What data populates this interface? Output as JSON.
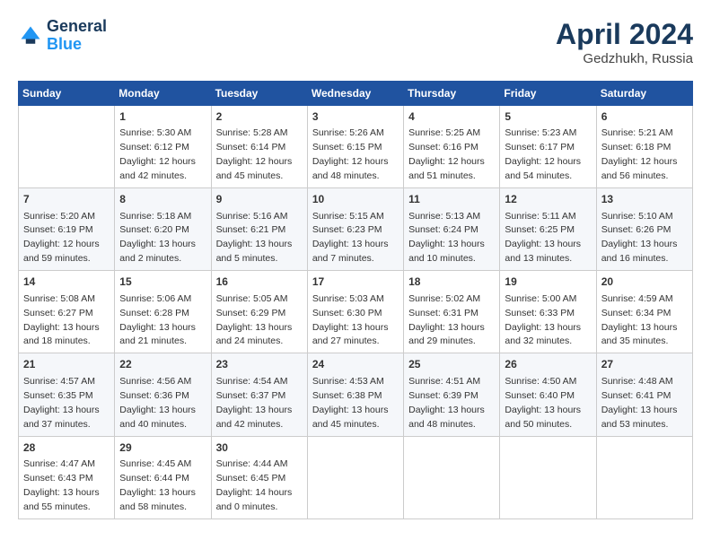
{
  "header": {
    "logo_general": "General",
    "logo_blue": "Blue",
    "month": "April 2024",
    "location": "Gedzhukh, Russia"
  },
  "weekdays": [
    "Sunday",
    "Monday",
    "Tuesday",
    "Wednesday",
    "Thursday",
    "Friday",
    "Saturday"
  ],
  "weeks": [
    [
      {
        "day": "",
        "info": ""
      },
      {
        "day": "1",
        "info": "Sunrise: 5:30 AM\nSunset: 6:12 PM\nDaylight: 12 hours\nand 42 minutes."
      },
      {
        "day": "2",
        "info": "Sunrise: 5:28 AM\nSunset: 6:14 PM\nDaylight: 12 hours\nand 45 minutes."
      },
      {
        "day": "3",
        "info": "Sunrise: 5:26 AM\nSunset: 6:15 PM\nDaylight: 12 hours\nand 48 minutes."
      },
      {
        "day": "4",
        "info": "Sunrise: 5:25 AM\nSunset: 6:16 PM\nDaylight: 12 hours\nand 51 minutes."
      },
      {
        "day": "5",
        "info": "Sunrise: 5:23 AM\nSunset: 6:17 PM\nDaylight: 12 hours\nand 54 minutes."
      },
      {
        "day": "6",
        "info": "Sunrise: 5:21 AM\nSunset: 6:18 PM\nDaylight: 12 hours\nand 56 minutes."
      }
    ],
    [
      {
        "day": "7",
        "info": "Sunrise: 5:20 AM\nSunset: 6:19 PM\nDaylight: 12 hours\nand 59 minutes."
      },
      {
        "day": "8",
        "info": "Sunrise: 5:18 AM\nSunset: 6:20 PM\nDaylight: 13 hours\nand 2 minutes."
      },
      {
        "day": "9",
        "info": "Sunrise: 5:16 AM\nSunset: 6:21 PM\nDaylight: 13 hours\nand 5 minutes."
      },
      {
        "day": "10",
        "info": "Sunrise: 5:15 AM\nSunset: 6:23 PM\nDaylight: 13 hours\nand 7 minutes."
      },
      {
        "day": "11",
        "info": "Sunrise: 5:13 AM\nSunset: 6:24 PM\nDaylight: 13 hours\nand 10 minutes."
      },
      {
        "day": "12",
        "info": "Sunrise: 5:11 AM\nSunset: 6:25 PM\nDaylight: 13 hours\nand 13 minutes."
      },
      {
        "day": "13",
        "info": "Sunrise: 5:10 AM\nSunset: 6:26 PM\nDaylight: 13 hours\nand 16 minutes."
      }
    ],
    [
      {
        "day": "14",
        "info": "Sunrise: 5:08 AM\nSunset: 6:27 PM\nDaylight: 13 hours\nand 18 minutes."
      },
      {
        "day": "15",
        "info": "Sunrise: 5:06 AM\nSunset: 6:28 PM\nDaylight: 13 hours\nand 21 minutes."
      },
      {
        "day": "16",
        "info": "Sunrise: 5:05 AM\nSunset: 6:29 PM\nDaylight: 13 hours\nand 24 minutes."
      },
      {
        "day": "17",
        "info": "Sunrise: 5:03 AM\nSunset: 6:30 PM\nDaylight: 13 hours\nand 27 minutes."
      },
      {
        "day": "18",
        "info": "Sunrise: 5:02 AM\nSunset: 6:31 PM\nDaylight: 13 hours\nand 29 minutes."
      },
      {
        "day": "19",
        "info": "Sunrise: 5:00 AM\nSunset: 6:33 PM\nDaylight: 13 hours\nand 32 minutes."
      },
      {
        "day": "20",
        "info": "Sunrise: 4:59 AM\nSunset: 6:34 PM\nDaylight: 13 hours\nand 35 minutes."
      }
    ],
    [
      {
        "day": "21",
        "info": "Sunrise: 4:57 AM\nSunset: 6:35 PM\nDaylight: 13 hours\nand 37 minutes."
      },
      {
        "day": "22",
        "info": "Sunrise: 4:56 AM\nSunset: 6:36 PM\nDaylight: 13 hours\nand 40 minutes."
      },
      {
        "day": "23",
        "info": "Sunrise: 4:54 AM\nSunset: 6:37 PM\nDaylight: 13 hours\nand 42 minutes."
      },
      {
        "day": "24",
        "info": "Sunrise: 4:53 AM\nSunset: 6:38 PM\nDaylight: 13 hours\nand 45 minutes."
      },
      {
        "day": "25",
        "info": "Sunrise: 4:51 AM\nSunset: 6:39 PM\nDaylight: 13 hours\nand 48 minutes."
      },
      {
        "day": "26",
        "info": "Sunrise: 4:50 AM\nSunset: 6:40 PM\nDaylight: 13 hours\nand 50 minutes."
      },
      {
        "day": "27",
        "info": "Sunrise: 4:48 AM\nSunset: 6:41 PM\nDaylight: 13 hours\nand 53 minutes."
      }
    ],
    [
      {
        "day": "28",
        "info": "Sunrise: 4:47 AM\nSunset: 6:43 PM\nDaylight: 13 hours\nand 55 minutes."
      },
      {
        "day": "29",
        "info": "Sunrise: 4:45 AM\nSunset: 6:44 PM\nDaylight: 13 hours\nand 58 minutes."
      },
      {
        "day": "30",
        "info": "Sunrise: 4:44 AM\nSunset: 6:45 PM\nDaylight: 14 hours\nand 0 minutes."
      },
      {
        "day": "",
        "info": ""
      },
      {
        "day": "",
        "info": ""
      },
      {
        "day": "",
        "info": ""
      },
      {
        "day": "",
        "info": ""
      }
    ]
  ]
}
